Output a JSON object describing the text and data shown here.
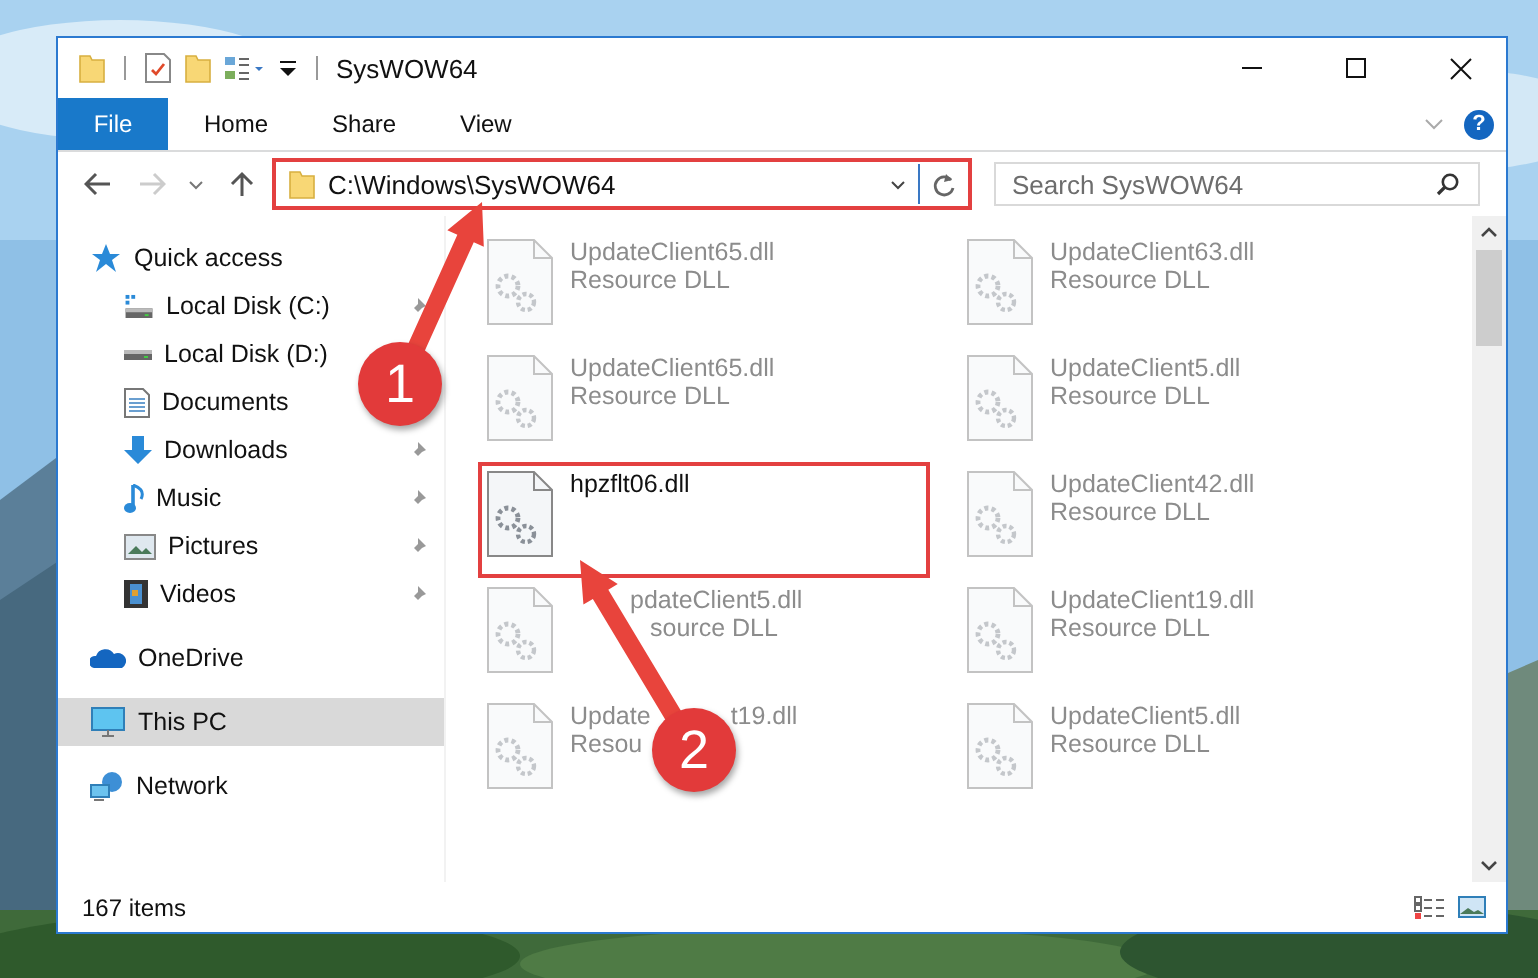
{
  "window": {
    "title": "SysWOW64",
    "help_label": "?"
  },
  "ribbon_tabs": [
    {
      "label": "File",
      "kind": "file"
    },
    {
      "label": "Home",
      "kind": "tab"
    },
    {
      "label": "Share",
      "kind": "tab"
    },
    {
      "label": "View",
      "kind": "tab"
    }
  ],
  "address": {
    "path": "C:\\Windows\\SysWOW64",
    "annotated": true
  },
  "search": {
    "placeholder": "Search SysWOW64"
  },
  "navigation": [
    {
      "label": "Quick access",
      "kind": "quick-access",
      "selected": false,
      "children": [
        {
          "label": "Local Disk (C:)",
          "kind": "drive-c",
          "selected": false,
          "pinned": true
        },
        {
          "label": "Local Disk (D:)",
          "kind": "drive",
          "selected": false
        },
        {
          "label": "Documents",
          "kind": "documents",
          "selected": false
        },
        {
          "label": "Downloads",
          "kind": "downloads",
          "selected": false,
          "pinned": true
        },
        {
          "label": "Music",
          "kind": "music",
          "selected": false,
          "pinned": true
        },
        {
          "label": "Pictures",
          "kind": "pictures",
          "selected": false,
          "pinned": true
        },
        {
          "label": "Videos",
          "kind": "videos",
          "selected": false,
          "pinned": true
        }
      ]
    },
    {
      "label": "OneDrive",
      "kind": "onedrive",
      "selected": false
    },
    {
      "label": "This PC",
      "kind": "pc",
      "selected": true
    },
    {
      "label": "Network",
      "kind": "network",
      "selected": false
    }
  ],
  "files": [
    {
      "name_parts": [
        "UpdateClient65.dll"
      ],
      "type": "Resource DLL",
      "annotated": false
    },
    {
      "name_parts": [
        "UpdateClient63.dll"
      ],
      "type": "Resource DLL",
      "annotated": false
    },
    {
      "name_parts": [
        "UpdateClient65.dll"
      ],
      "type": "Resource DLL",
      "annotated": false
    },
    {
      "name_parts": [
        "UpdateClient5.dll"
      ],
      "type": "Resource DLL",
      "annotated": false
    },
    {
      "name_parts": [
        "hpzflt06.dll"
      ],
      "annotated": true
    },
    {
      "name_parts": [
        "UpdateClient42.dll"
      ],
      "type": "Resource DLL",
      "annotated": false
    },
    {
      "name_parts": [
        "pdateClient5.dll"
      ],
      "type": "source DLL",
      "hidden_start": true,
      "annotated": false
    },
    {
      "name_parts": [
        "UpdateClient19.dll"
      ],
      "type": "Resource DLL",
      "annotated": false
    },
    {
      "name_parts": [
        "Update",
        "t19.dll"
      ],
      "type": "Resou",
      "hidden_middle": true,
      "annotated": false
    },
    {
      "name_parts": [
        "UpdateClient5.dll"
      ],
      "type": "Resource DLL",
      "annotated": false
    }
  ],
  "status_bar": {
    "item_count": "167 items"
  },
  "annotations": [
    {
      "number": "1"
    },
    {
      "number": "2"
    }
  ]
}
